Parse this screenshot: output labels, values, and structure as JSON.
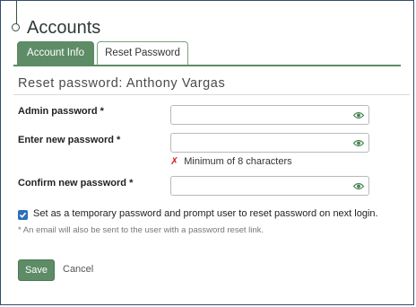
{
  "page": {
    "title": "Accounts"
  },
  "tabs": [
    {
      "label": "Account Info",
      "active": true
    },
    {
      "label": "Reset Password",
      "active": false
    }
  ],
  "section": {
    "title": "Reset password: Anthony Vargas"
  },
  "fields": {
    "admin_password": {
      "label": "Admin password *",
      "value": ""
    },
    "new_password": {
      "label": "Enter new password *",
      "value": ""
    },
    "confirm_password": {
      "label": "Confirm new password *",
      "value": ""
    }
  },
  "validation": {
    "icon": "✗",
    "message": "Minimum of 8 characters"
  },
  "temporary_password": {
    "checked": true,
    "label": "Set as a temporary password and prompt user to reset password on next login."
  },
  "note": "* An email will also be sent to the user with a password reset link.",
  "actions": {
    "save_label": "Save",
    "cancel_label": "Cancel"
  },
  "colors": {
    "accent": "#5d8c66",
    "checkbox": "#2b6fb8",
    "error": "#d42020"
  },
  "icons": {
    "visibility": "eye-icon",
    "checkbox": "checkmark-icon",
    "error": "x-icon"
  }
}
